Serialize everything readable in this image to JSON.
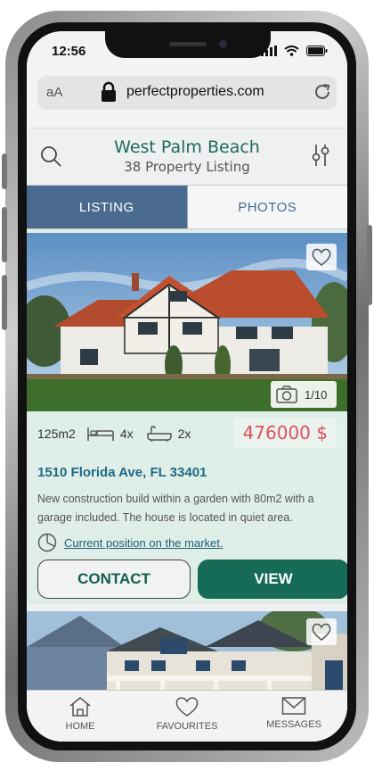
{
  "status_bar": {
    "time": "12:56"
  },
  "browser": {
    "text_size_label": "aA",
    "url": "perfectproperties.com"
  },
  "header": {
    "title": "West Palm Beach",
    "subtitle": "38 Property Listing"
  },
  "tabs": [
    {
      "label": "LISTING",
      "active": true
    },
    {
      "label": "PHOTOS",
      "active": false
    }
  ],
  "listing": {
    "photo_counter": "1/10",
    "area": "125m2",
    "bedrooms": "4x",
    "bathrooms": "2x",
    "price": "476000 $",
    "address": "1510 Florida Ave, FL 33401",
    "description": "New construction build within a garden with 80m2 with a garage included.  The house is located in quiet area.",
    "market_link": "Current position on the market.",
    "contact_label": "CONTACT",
    "view_label": "VIEW"
  },
  "bottom_nav": [
    {
      "label": "HOME",
      "icon": "home-icon"
    },
    {
      "label": "FAVOURITES",
      "icon": "heart-icon"
    },
    {
      "label": "MESSAGES",
      "icon": "envelope-icon"
    }
  ],
  "colors": {
    "accent_green": "#166b56",
    "tab_blue": "#4a6b8f",
    "price_red": "#e0505a",
    "card_bg": "#dfeee6"
  }
}
